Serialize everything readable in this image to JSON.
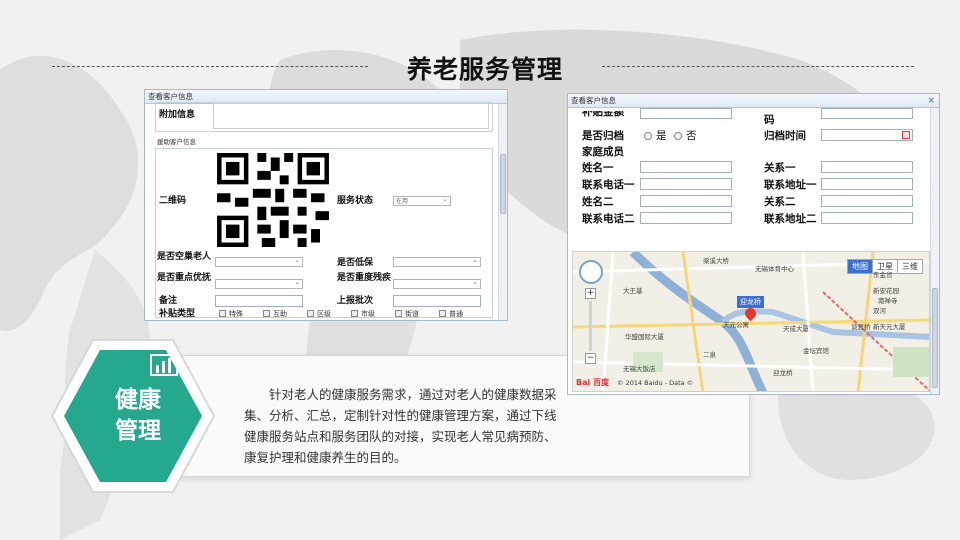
{
  "page": {
    "title": "养老服务管理",
    "badge_title": "健康\n管理",
    "description": "针对老人的健康服务需求，通过对老人的健康数据采集、分析、汇总，定制针对性的健康管理方案，通过下线健康服务站点和服务团队的对接，实现老人常见病预防、康复护理和健康养生的目的。"
  },
  "colors": {
    "accent": "#26a88f",
    "accent_dark": "#1b8c77"
  },
  "icons": {
    "badge_icon": "bar-chart-icon",
    "map_marker": "location-pin-icon"
  },
  "window1": {
    "title": "查看客户信息",
    "extra_info_label": "附加信息",
    "section_label": "援助客户信息",
    "qr_label": "二维码",
    "service_status_label": "服务状态",
    "service_status_value": "在用",
    "empty_nest_label": "是否空巢老人",
    "low_income_label": "是否低保",
    "priority_label": "是否重点优抚",
    "disability_label": "是否重度残疾",
    "remark_label": "备注",
    "report_batch_label": "上报批次",
    "subsidy_type_label": "补贴类型",
    "subsidy_options": [
      "特殊",
      "互助",
      "区级",
      "市级",
      "街道",
      "普通"
    ]
  },
  "window2": {
    "title": "查看客户信息",
    "subsidy_amount_label": "补贴金额",
    "code_label": "码",
    "archived_label": "是否归档",
    "archived_yes": "是",
    "archived_no": "否",
    "archive_time_label": "归档时间",
    "family_label": "家庭成员",
    "name1_label": "姓名一",
    "relation1_label": "关系一",
    "phone1_label": "联系电话一",
    "address1_label": "联系地址一",
    "name2_label": "姓名二",
    "relation2_label": "关系二",
    "phone2_label": "联系电话二",
    "address2_label": "联系地址二",
    "map": {
      "tabs": [
        "地图",
        "卫星",
        "三维"
      ],
      "active_tab": "地图",
      "places": [
        "梁溪大桥",
        "无锡体育中心",
        "东金贸",
        "大王基",
        "新安花园",
        "南禅寺",
        "双河",
        "华盟国际大厦",
        "天元公寓",
        "天成大厦",
        "谈渡桥",
        "新天元大厦",
        "金坛宾馆",
        "二泉",
        "迎龙桥",
        "无锡大饭店"
      ],
      "marker_label": "迎龙桥",
      "copyright": "© 2014 Baidu - Data ©",
      "logo": "Bai 百度"
    }
  }
}
